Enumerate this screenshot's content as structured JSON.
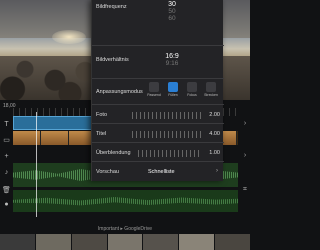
{
  "timeline": {
    "timecode": "18,00"
  },
  "footer": {
    "label": "Important ▸ GoogleDrive"
  },
  "settings": {
    "frame_rate": {
      "label": "Bildfrequenz",
      "selected": "30",
      "options_below": [
        "50",
        "60"
      ]
    },
    "aspect_ratio": {
      "label": "Bildverhältnis",
      "selected": "16:9",
      "options_below": [
        "9:16"
      ]
    },
    "fit_mode": {
      "label": "Anpassungsmodus",
      "options": [
        "Passend",
        "Füllen",
        "Fokus",
        "Strecken"
      ],
      "active_index": 1
    },
    "photo": {
      "label": "Foto",
      "value": "2.00"
    },
    "title": {
      "label": "Titel",
      "value": "4.00"
    },
    "crossfade": {
      "label": "Überblendung",
      "value": "1.00"
    },
    "preview": {
      "label": "Vorschau",
      "value": "Schnelliste"
    }
  },
  "colors": {
    "accent": "#2a7fd4",
    "panel": "#232326",
    "title_clip": "#2a6e9a",
    "audio": "#1e3d1e"
  }
}
